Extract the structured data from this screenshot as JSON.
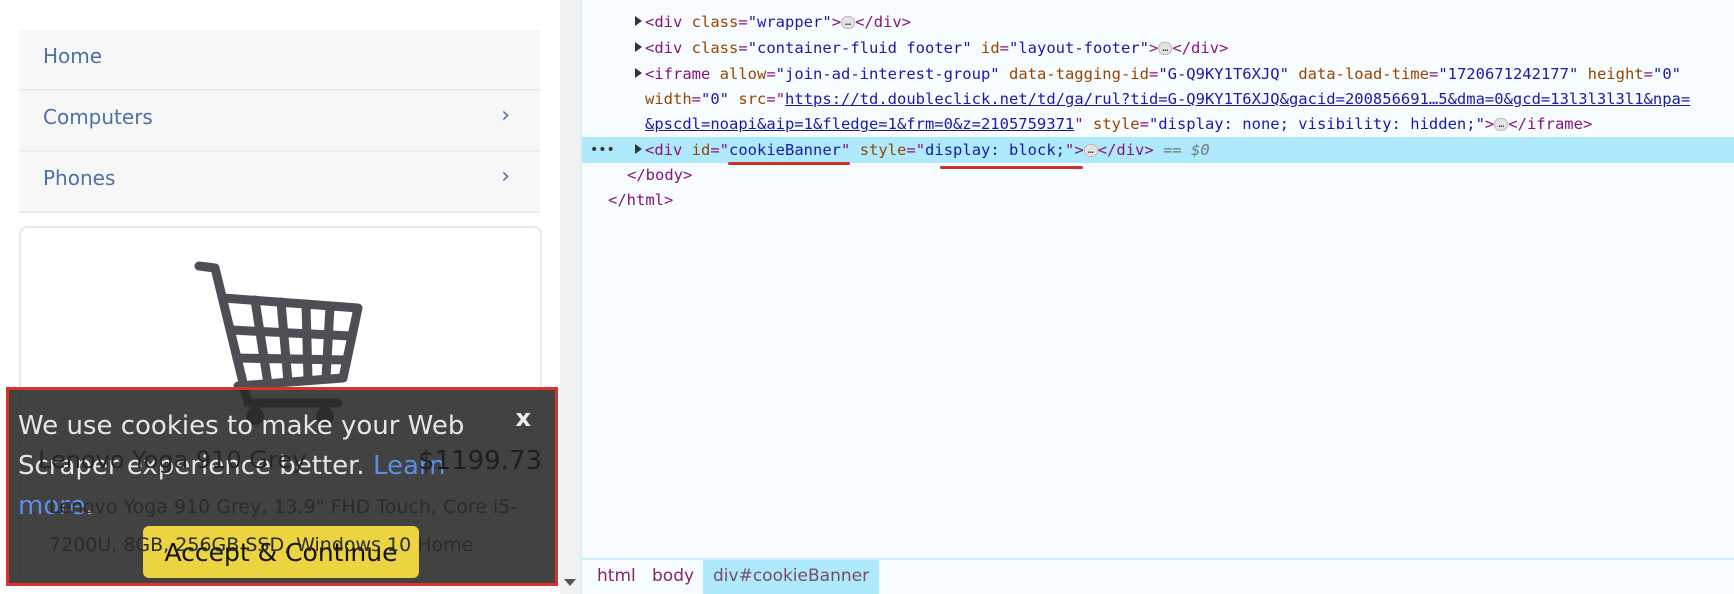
{
  "page": {
    "nav": [
      {
        "label": "Home",
        "has_chevron": false
      },
      {
        "label": "Computers",
        "has_chevron": true
      },
      {
        "label": "Phones",
        "has_chevron": true
      }
    ],
    "chevron": "›",
    "product": {
      "image_icon": "shopping-cart-icon",
      "title": "Lenovo Yoga 910 Grey",
      "price": "$1199.73",
      "description": "Lenovo Yoga 910 Grey, 13.9\" FHD Touch, Core i5-7200U, 8GB, 256GB SSD, Windows 10 Home"
    },
    "cookie_banner": {
      "message": "We use cookies to make your Web Scraper experience better.",
      "link": "Learn more",
      "link_suffix": ".",
      "close_label": "x",
      "accept_label": "Accept & Continue",
      "highlight_color": "#d9342b"
    }
  },
  "devtools": {
    "lines": {
      "wrapper": {
        "tag_open": "<div ",
        "attr": "class",
        "value": "\"wrapper\"",
        "close": ">",
        "end": "</div>"
      },
      "footer": {
        "tag_open": "<div ",
        "attr1": "class",
        "value1": "\"container-fluid footer\"",
        "attr2": "id",
        "value2": "\"layout-footer\"",
        "close": ">",
        "end": "</div>"
      },
      "iframe": {
        "tag_open": "<iframe ",
        "a1": "allow",
        "v1": "\"join-ad-interest-group\"",
        "a2": "data-tagging-id",
        "v2": "\"G-Q9KY1T6XJQ\"",
        "a3": "data-load-time",
        "v3": "\"1720671242177\"",
        "a4": "height",
        "v4": "\"0\"",
        "a5": "width",
        "v5": "\"0\"",
        "a6": "src",
        "src_part1": "https://td.doubleclick.net/td/ga/rul?tid=G-Q9KY1T6XJQ&gacid=200856691…5&dma=0&gcd=13l3l3l3l1&npa=",
        "src_part2": "&pscdl=noapi&aip=1&fledge=1&frm=0&z=2105759371",
        "a7": "style",
        "v7": "\"display: none; visibility: hidden;\"",
        "end": "</iframe>"
      },
      "cookie": {
        "tag_open": "<div ",
        "attr1": "id",
        "value1": "cookieBanner",
        "attr2": "style",
        "value2": "display: block;",
        "end": "</div>",
        "eq": "== $0"
      },
      "body_close": "</body>",
      "html_close": "</html>"
    },
    "ellipsis": "…",
    "gutter_dots": "•••",
    "breadcrumbs": [
      "html",
      "body",
      "div#cookieBanner"
    ],
    "selected_color": "#aeeafc"
  }
}
